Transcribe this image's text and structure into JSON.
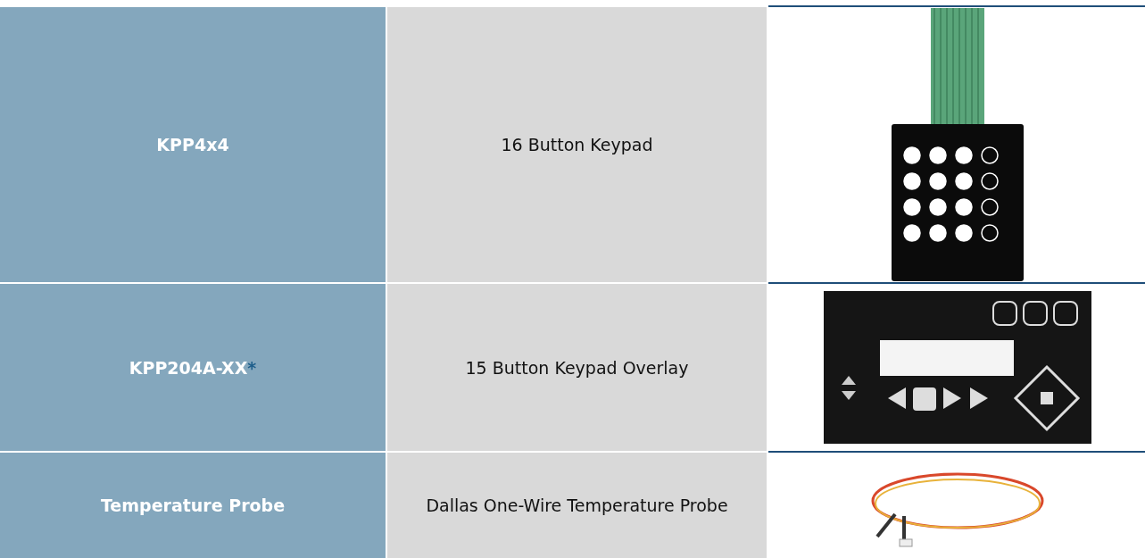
{
  "table": {
    "rows": [
      {
        "name": "KPP4x4",
        "description": "16 Button Keypad",
        "kind": "keypad"
      },
      {
        "name": "KPP204A-XX",
        "footnote_mark": "*",
        "description": "15 Button Keypad Overlay",
        "kind": "overlay"
      },
      {
        "name": "Temperature Probe",
        "description": "Dallas One-Wire Temperature Probe",
        "kind": "cable"
      }
    ]
  }
}
